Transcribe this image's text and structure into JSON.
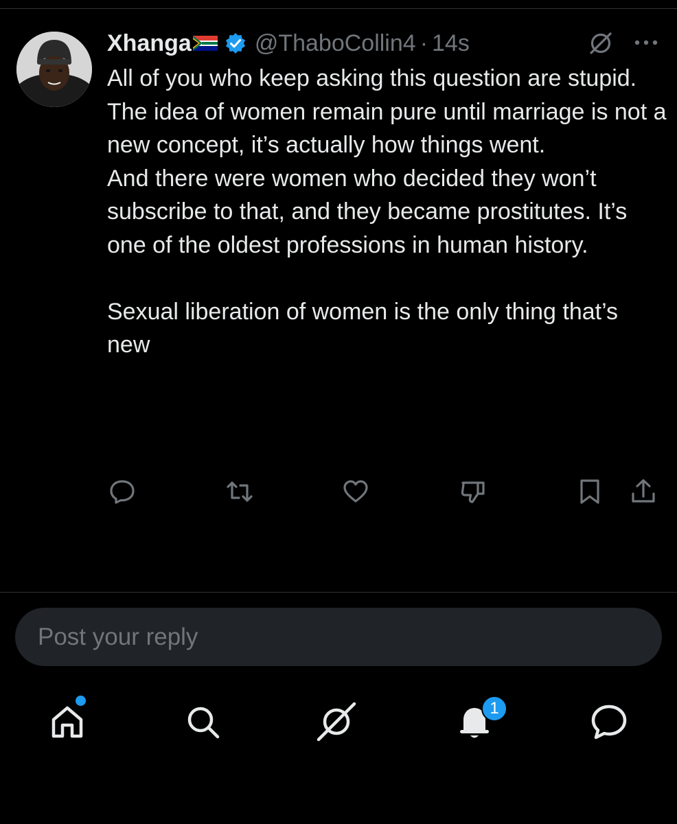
{
  "post": {
    "author": {
      "display_name": "Xhanga",
      "flag": "south-africa-flag",
      "verified": true,
      "handle": "@ThaboCollin4",
      "separator": "·",
      "time": "14s"
    },
    "lines": [
      "All of you who keep asking this question are stupid.",
      "The idea of women remain pure until marriage is not a new concept, it’s actually how things went.",
      "And there were women who decided they won’t subscribe to that, and they became prostitutes. It’s one of the oldest professions in human history.",
      "",
      "Sexual liberation of women is the only thing that’s new"
    ],
    "actions": [
      "reply-icon",
      "repost-icon",
      "like-icon",
      "downvote-icon",
      "bookmark-icon",
      "share-icon"
    ],
    "top_right_icons": [
      "grok-icon",
      "more-icon"
    ]
  },
  "reply": {
    "placeholder": "Post your reply"
  },
  "tab_bar": {
    "tabs": [
      "home-icon",
      "search-icon",
      "grok-icon",
      "notifications-icon",
      "messages-icon"
    ],
    "notifications_badge": "1",
    "home_has_dot": true
  },
  "colors": {
    "background": "#000000",
    "text": "#e7e9ea",
    "secondary_text": "#71767b",
    "accent": "#1d9bf0",
    "divider": "#2f3336",
    "reply_box": "#202327"
  }
}
